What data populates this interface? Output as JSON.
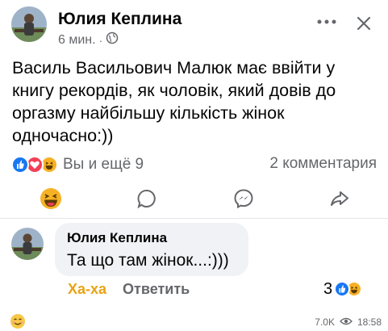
{
  "post": {
    "author": "Юлия Кеплина",
    "time": "6 мин.",
    "dot": "·",
    "text": "Василь Васильович Малюк має ввійти у книгу рекордів, як чоловік, який довів до оргазму найбільшу кількість жінок одночасно:))",
    "reactions_text": "Вы и ещё 9",
    "comments_text": "2 комментария"
  },
  "comment": {
    "author": "Юлия Кеплина",
    "text": "Та що там жінок...:)))",
    "reaction_label": "Ха-ха",
    "reply_label": "Ответить",
    "reaction_count": "3"
  },
  "footer": {
    "views": "7.0K",
    "time": "18:58"
  },
  "colors": {
    "like_blue": "#1877f2",
    "love_red": "#f33e58",
    "haha_yellow": "#f7b125",
    "muted": "#65676b"
  },
  "icons": [
    "globe-icon",
    "more-icon",
    "close-icon",
    "like-icon",
    "love-icon",
    "haha-icon",
    "comment-icon",
    "messenger-icon",
    "share-icon",
    "eye-icon"
  ]
}
